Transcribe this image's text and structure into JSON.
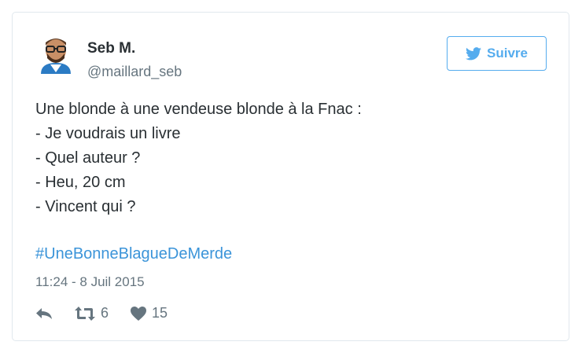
{
  "author": {
    "name": "Seb M.",
    "handle": "@maillard_seb"
  },
  "follow_button": {
    "label": "Suivre",
    "icon": "twitter-bird-icon"
  },
  "tweet": {
    "lines": [
      "Une blonde à une vendeuse blonde à la Fnac :",
      "- Je voudrais un livre",
      "- Quel auteur ?",
      "- Heu, 20 cm",
      "- Vincent qui ?"
    ],
    "hashtag": "#UneBonneBlagueDeMerde",
    "timestamp": "11:24 - 8 Juil 2015"
  },
  "actions": {
    "reply": {
      "icon": "reply-icon"
    },
    "retweet": {
      "icon": "retweet-icon",
      "count": "6"
    },
    "like": {
      "icon": "heart-icon",
      "count": "15"
    }
  },
  "colors": {
    "accent": "#55acee",
    "link": "#3b94d9",
    "muted": "#66757f",
    "text": "#292f33",
    "border": "#e1e8ed"
  }
}
